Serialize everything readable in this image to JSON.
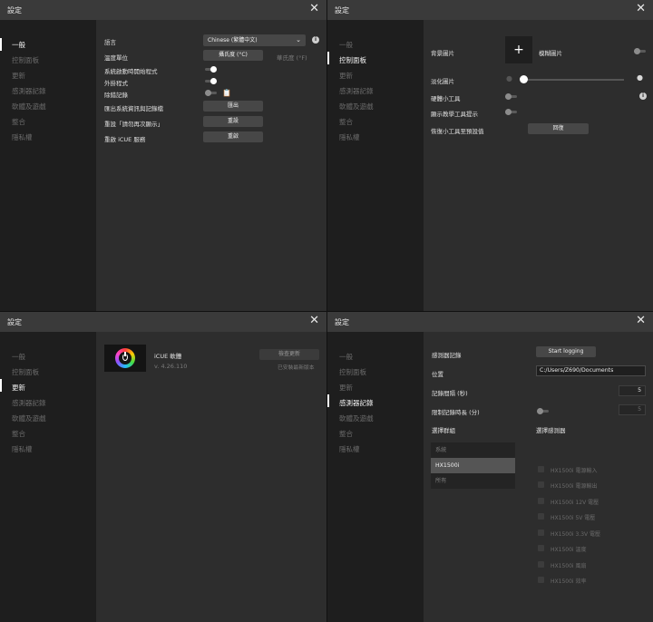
{
  "window_title": "設定",
  "close_glyph": "✕",
  "nav": [
    "一般",
    "控制面板",
    "更新",
    "感測器記錄",
    "軟體及遊戲",
    "整合",
    "隱私權"
  ],
  "general": {
    "language_label": "語言",
    "language_value": "Chinese (繁體中文)",
    "temp_label": "溫度單位",
    "celsius": "攝氏度 (°C)",
    "fahrenheit": "華氏度 (°F)",
    "startup_label": "系統啟動時開始程式",
    "startup_on": true,
    "plugins_label": "外掛程式",
    "plugins_on": true,
    "debug_label": "除錯記錄",
    "debug_on": false,
    "export_label": "匯出系統資訊與記錄檔",
    "export_btn": "匯出",
    "reset_prompt_label": "重設「請勿再次顯示」",
    "reset_btn": "重設",
    "restart_label": "重啟 iCUE 服務",
    "restart_btn": "重啟"
  },
  "dashboard": {
    "bg_image_label": "背景圖片",
    "add_glyph": "+",
    "blur_label": "模糊圖片",
    "blur_on": false,
    "fade_label": "淡化圖片",
    "fade_level": 0,
    "hw_widgets_label": "硬體小工具",
    "hw_widgets_on": false,
    "show_tips_label": "顯示教學工具提示",
    "show_tips_on": false,
    "restore_label": "恢復小工具至預設值",
    "restore_btn": "回復"
  },
  "update": {
    "app_name": "iCUE 軟體",
    "version": "v. 4.26.110",
    "check_btn": "檢查更新",
    "status": "已安裝最新版本"
  },
  "sensor": {
    "logging_label": "感測器記錄",
    "start_btn": "Start logging",
    "location_label": "位置",
    "location_value": "C:/Users/Z690/Documents",
    "interval_label": "記錄間隔 (秒)",
    "interval_value": "5",
    "limit_label": "限制記錄時長 (分)",
    "limit_on": false,
    "limit_value": "5",
    "group_header": "選擇群組",
    "groups": [
      "系統",
      "HX1500i",
      "所有"
    ],
    "selected_group_index": 1,
    "sensor_header": "選擇感測器",
    "sensors": [
      "HX1500i 電源輸入",
      "HX1500i 電源輸出",
      "HX1500i 12V 電壓",
      "HX1500i 5V 電壓",
      "HX1500i 3.3V 電壓",
      "HX1500i 溫度",
      "HX1500i 風扇",
      "HX1500i 效率"
    ]
  }
}
